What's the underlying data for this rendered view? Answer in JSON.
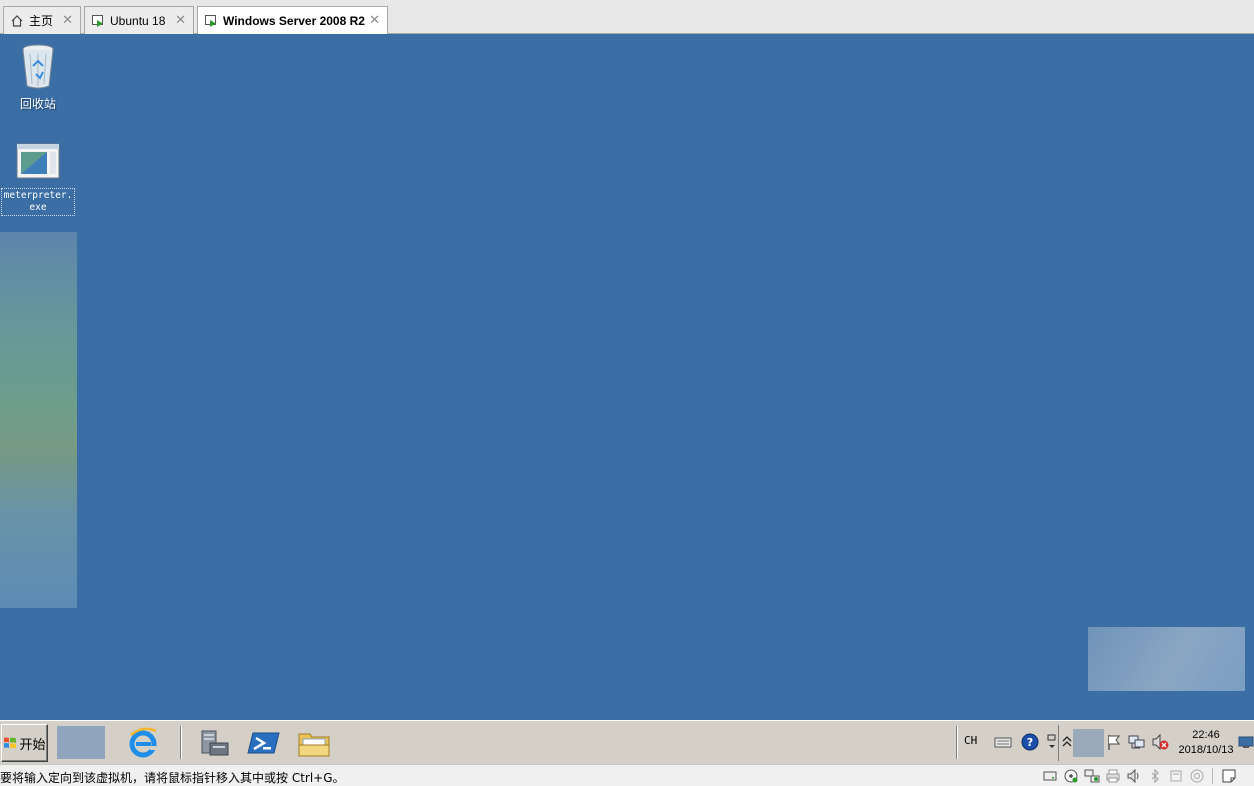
{
  "tabs": [
    {
      "label": "主页",
      "icon": "home-icon",
      "active": false
    },
    {
      "label": "Ubuntu 18",
      "icon": "vm-running-icon",
      "active": false
    },
    {
      "label": "Windows Server 2008 R2",
      "icon": "vm-running-icon",
      "active": true
    }
  ],
  "desktop": {
    "background_color": "#3a6ea5",
    "icons": [
      {
        "label": "回收站",
        "icon": "recycle-bin-icon"
      },
      {
        "label": "meterpreter.exe",
        "icon": "executable-icon"
      }
    ]
  },
  "taskbar": {
    "start_label": "开始",
    "pinned": [
      {
        "name": "internet-explorer",
        "icon": "internet-explorer-icon"
      },
      {
        "name": "server-manager",
        "icon": "server-manager-icon"
      },
      {
        "name": "powershell",
        "icon": "powershell-icon"
      },
      {
        "name": "file-explorer",
        "icon": "folder-icon"
      }
    ],
    "tray": {
      "language": "CH",
      "time": "22:46",
      "date": "2018/10/13"
    }
  },
  "statusbar": {
    "message": "要将输入定向到该虚拟机，请将鼠标指针移入其中或按 Ctrl+G。"
  },
  "colors": {
    "desktop": "#3a6ea5",
    "taskbar": "#d4d0c8",
    "tab_active": "#ffffff"
  }
}
